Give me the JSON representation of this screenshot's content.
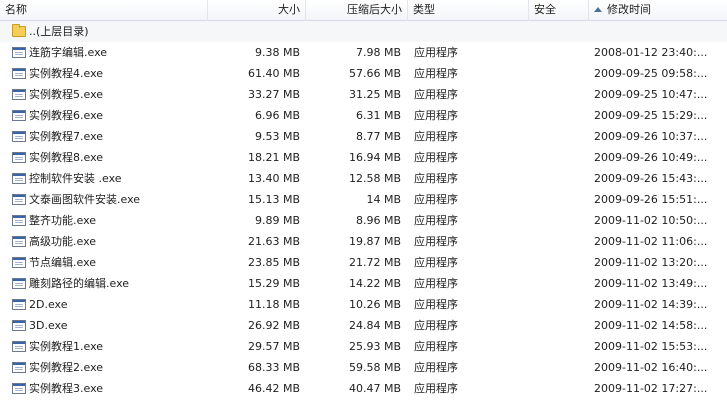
{
  "columns": {
    "name": "名称",
    "size": "大小",
    "compressed": "压缩后大小",
    "type": "类型",
    "security": "安全",
    "modified": "修改时间"
  },
  "parent_folder": "..(上层目录)",
  "files": [
    {
      "name": "连筋字编辑.exe",
      "size": "9.38 MB",
      "compressed": "7.98 MB",
      "type": "应用程序",
      "security": "",
      "modified": "2008-01-12 23:40:..."
    },
    {
      "name": "实例教程4.exe",
      "size": "61.40 MB",
      "compressed": "57.66 MB",
      "type": "应用程序",
      "security": "",
      "modified": "2009-09-25 09:58:..."
    },
    {
      "name": "实例教程5.exe",
      "size": "33.27 MB",
      "compressed": "31.25 MB",
      "type": "应用程序",
      "security": "",
      "modified": "2009-09-25 10:47:..."
    },
    {
      "name": "实例教程6.exe",
      "size": "6.96 MB",
      "compressed": "6.31 MB",
      "type": "应用程序",
      "security": "",
      "modified": "2009-09-25 15:29:..."
    },
    {
      "name": "实例教程7.exe",
      "size": "9.53 MB",
      "compressed": "8.77 MB",
      "type": "应用程序",
      "security": "",
      "modified": "2009-09-26 10:37:..."
    },
    {
      "name": "实例教程8.exe",
      "size": "18.21 MB",
      "compressed": "16.94 MB",
      "type": "应用程序",
      "security": "",
      "modified": "2009-09-26 10:49:..."
    },
    {
      "name": "控制软件安装 .exe",
      "size": "13.40 MB",
      "compressed": "12.58 MB",
      "type": "应用程序",
      "security": "",
      "modified": "2009-09-26 15:43:..."
    },
    {
      "name": "文泰画图软件安装.exe",
      "size": "15.13 MB",
      "compressed": "14 MB",
      "type": "应用程序",
      "security": "",
      "modified": "2009-09-26 15:51:..."
    },
    {
      "name": "整齐功能.exe",
      "size": "9.89 MB",
      "compressed": "8.96 MB",
      "type": "应用程序",
      "security": "",
      "modified": "2009-11-02 10:50:..."
    },
    {
      "name": "高级功能.exe",
      "size": "21.63 MB",
      "compressed": "19.87 MB",
      "type": "应用程序",
      "security": "",
      "modified": "2009-11-02 11:06:..."
    },
    {
      "name": "节点编辑.exe",
      "size": "23.85 MB",
      "compressed": "21.72 MB",
      "type": "应用程序",
      "security": "",
      "modified": "2009-11-02 13:20:..."
    },
    {
      "name": "雕刻路径的编辑.exe",
      "size": "15.29 MB",
      "compressed": "14.22 MB",
      "type": "应用程序",
      "security": "",
      "modified": "2009-11-02 13:49:..."
    },
    {
      "name": "2D.exe",
      "size": "11.18 MB",
      "compressed": "10.26 MB",
      "type": "应用程序",
      "security": "",
      "modified": "2009-11-02 14:39:..."
    },
    {
      "name": "3D.exe",
      "size": "26.92 MB",
      "compressed": "24.84 MB",
      "type": "应用程序",
      "security": "",
      "modified": "2009-11-02 14:58:..."
    },
    {
      "name": "实例教程1.exe",
      "size": "29.57 MB",
      "compressed": "25.93 MB",
      "type": "应用程序",
      "security": "",
      "modified": "2009-11-02 15:53:..."
    },
    {
      "name": "实例教程2.exe",
      "size": "68.33 MB",
      "compressed": "59.58 MB",
      "type": "应用程序",
      "security": "",
      "modified": "2009-11-02 16:40:..."
    },
    {
      "name": "实例教程3.exe",
      "size": "46.42 MB",
      "compressed": "40.47 MB",
      "type": "应用程序",
      "security": "",
      "modified": "2009-11-02 17:27:..."
    }
  ]
}
